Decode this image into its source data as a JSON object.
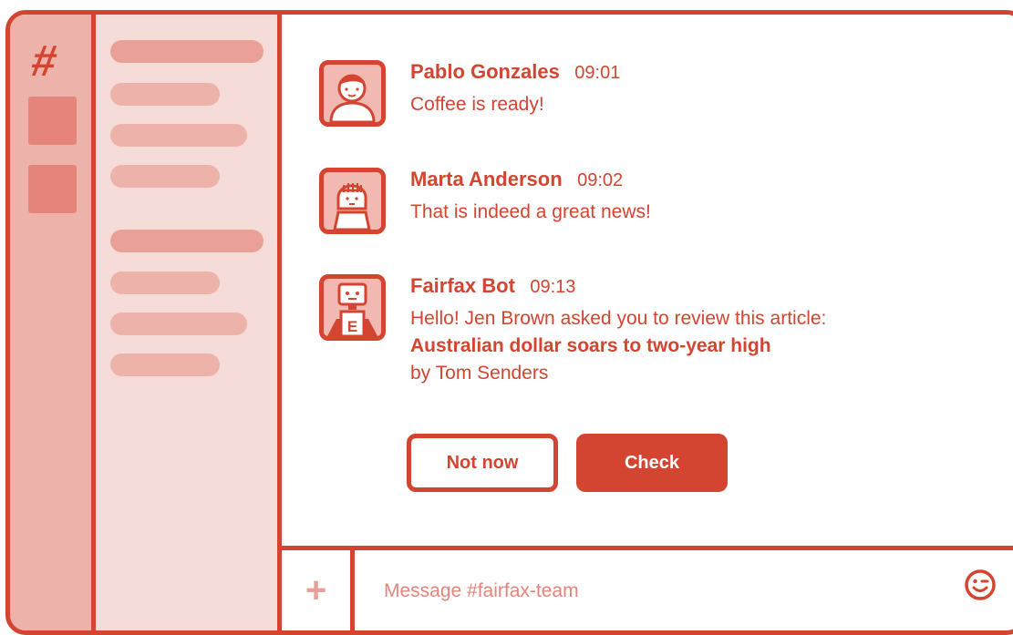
{
  "channel": {
    "name": "#fairfax-team"
  },
  "messages": [
    {
      "author": "Pablo Gonzales",
      "time": "09:01",
      "text": "Coffee is ready!",
      "avatar": "man-avatar-icon"
    },
    {
      "author": "Marta Anderson",
      "time": "09:02",
      "text": "That is indeed a great news!",
      "avatar": "woman-avatar-icon"
    },
    {
      "author": "Fairfax Bot",
      "time": "09:13",
      "text": "Hello! Jen Brown asked you to review this article:",
      "article_title": "Australian dollar soars to two-year high",
      "byline": "by Tom Senders",
      "avatar": "robot-avatar-icon"
    }
  ],
  "actions": {
    "not_now": "Not now",
    "check": "Check"
  },
  "composer": {
    "placeholder": "Message #fairfax-team",
    "plus": "+"
  },
  "colors": {
    "accent": "#d34530",
    "rail": "#edb3aa",
    "sidebar": "#f6dcd8"
  }
}
